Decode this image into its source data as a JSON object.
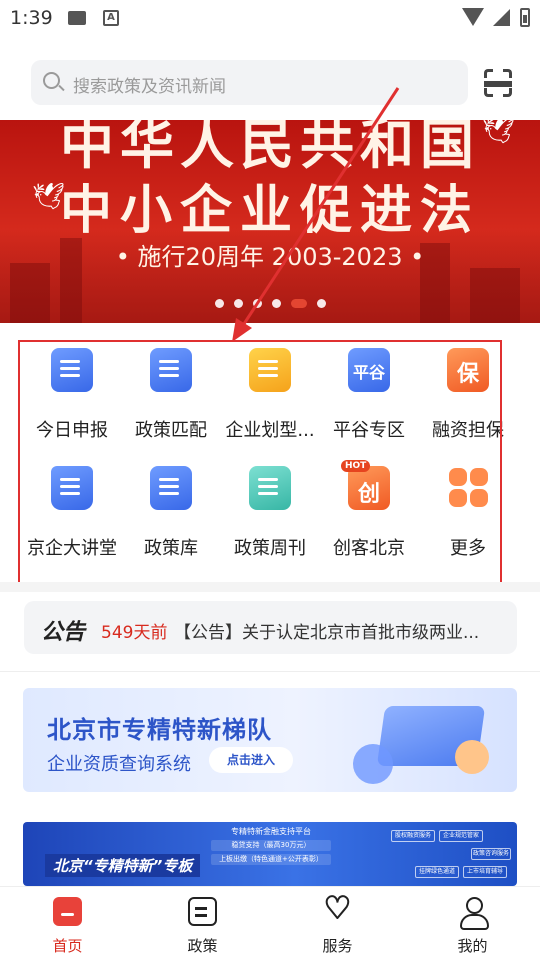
{
  "status": {
    "time": "1:39",
    "keyboard_icon": "A"
  },
  "search": {
    "placeholder": "搜索政策及资讯新闻"
  },
  "banner": {
    "line1": "中华人民共和国",
    "line2": "中小企业促进法",
    "line3": "• 施行20周年 2003-2023 •",
    "slide_count": 6,
    "active_slide": 5
  },
  "grid": {
    "items": [
      {
        "label": "今日申报",
        "icon": "upload-document-icon",
        "color": "#3868e8"
      },
      {
        "label": "政策匹配",
        "icon": "open-book-icon",
        "color": "#3868e8"
      },
      {
        "label": "企业划型...",
        "icon": "document-check-icon",
        "color": "#f5a21b"
      },
      {
        "label": "平谷专区",
        "icon": "pinggu-location-icon",
        "color": "#3868e8"
      },
      {
        "label": "融资担保",
        "icon": "guarantee-shield-icon",
        "color": "#f05a24"
      },
      {
        "label": "京企大讲堂",
        "icon": "book-icon",
        "color": "#3868e8"
      },
      {
        "label": "政策库",
        "icon": "document-star-icon",
        "color": "#3868e8"
      },
      {
        "label": "政策周刊",
        "icon": "bookmark-document-icon",
        "color": "#37b6a5"
      },
      {
        "label": "创客北京",
        "icon": "chuang-hot-icon",
        "color": "#f05a24"
      },
      {
        "label": "更多",
        "icon": "grid-more-icon",
        "color": "#ff8b4c"
      }
    ],
    "hot_badge": "HOT",
    "glyph_pinggu": "平谷",
    "glyph_bao": "保",
    "glyph_chuang": "创"
  },
  "notice": {
    "tag": "公告",
    "days": "549天前",
    "text": "【公告】关于认定北京市首批市级两业..."
  },
  "promo": {
    "title": "北京市专精特新梯队",
    "subtitle": "企业资质查询系统",
    "button": "点击进入"
  },
  "banner2": {
    "title": "北京“专精特新”专板",
    "center_title": "专精特新金融支持平台",
    "center_line1": "稳贷支持（最高30万元）",
    "center_line2": "上板出缴（特色通道+公开表彰）",
    "chips": [
      "股权融资服务",
      "企业规范管家",
      "政策咨询服务",
      "挂牌绿色通道",
      "上市培育辅导"
    ]
  },
  "tabbar": {
    "tabs": [
      {
        "label": "首页",
        "active": true
      },
      {
        "label": "政策",
        "active": false
      },
      {
        "label": "服务",
        "active": false
      },
      {
        "label": "我的",
        "active": false
      }
    ]
  },
  "colors": {
    "brand_red": "#d82a1e",
    "annotation_red": "#e03030"
  }
}
